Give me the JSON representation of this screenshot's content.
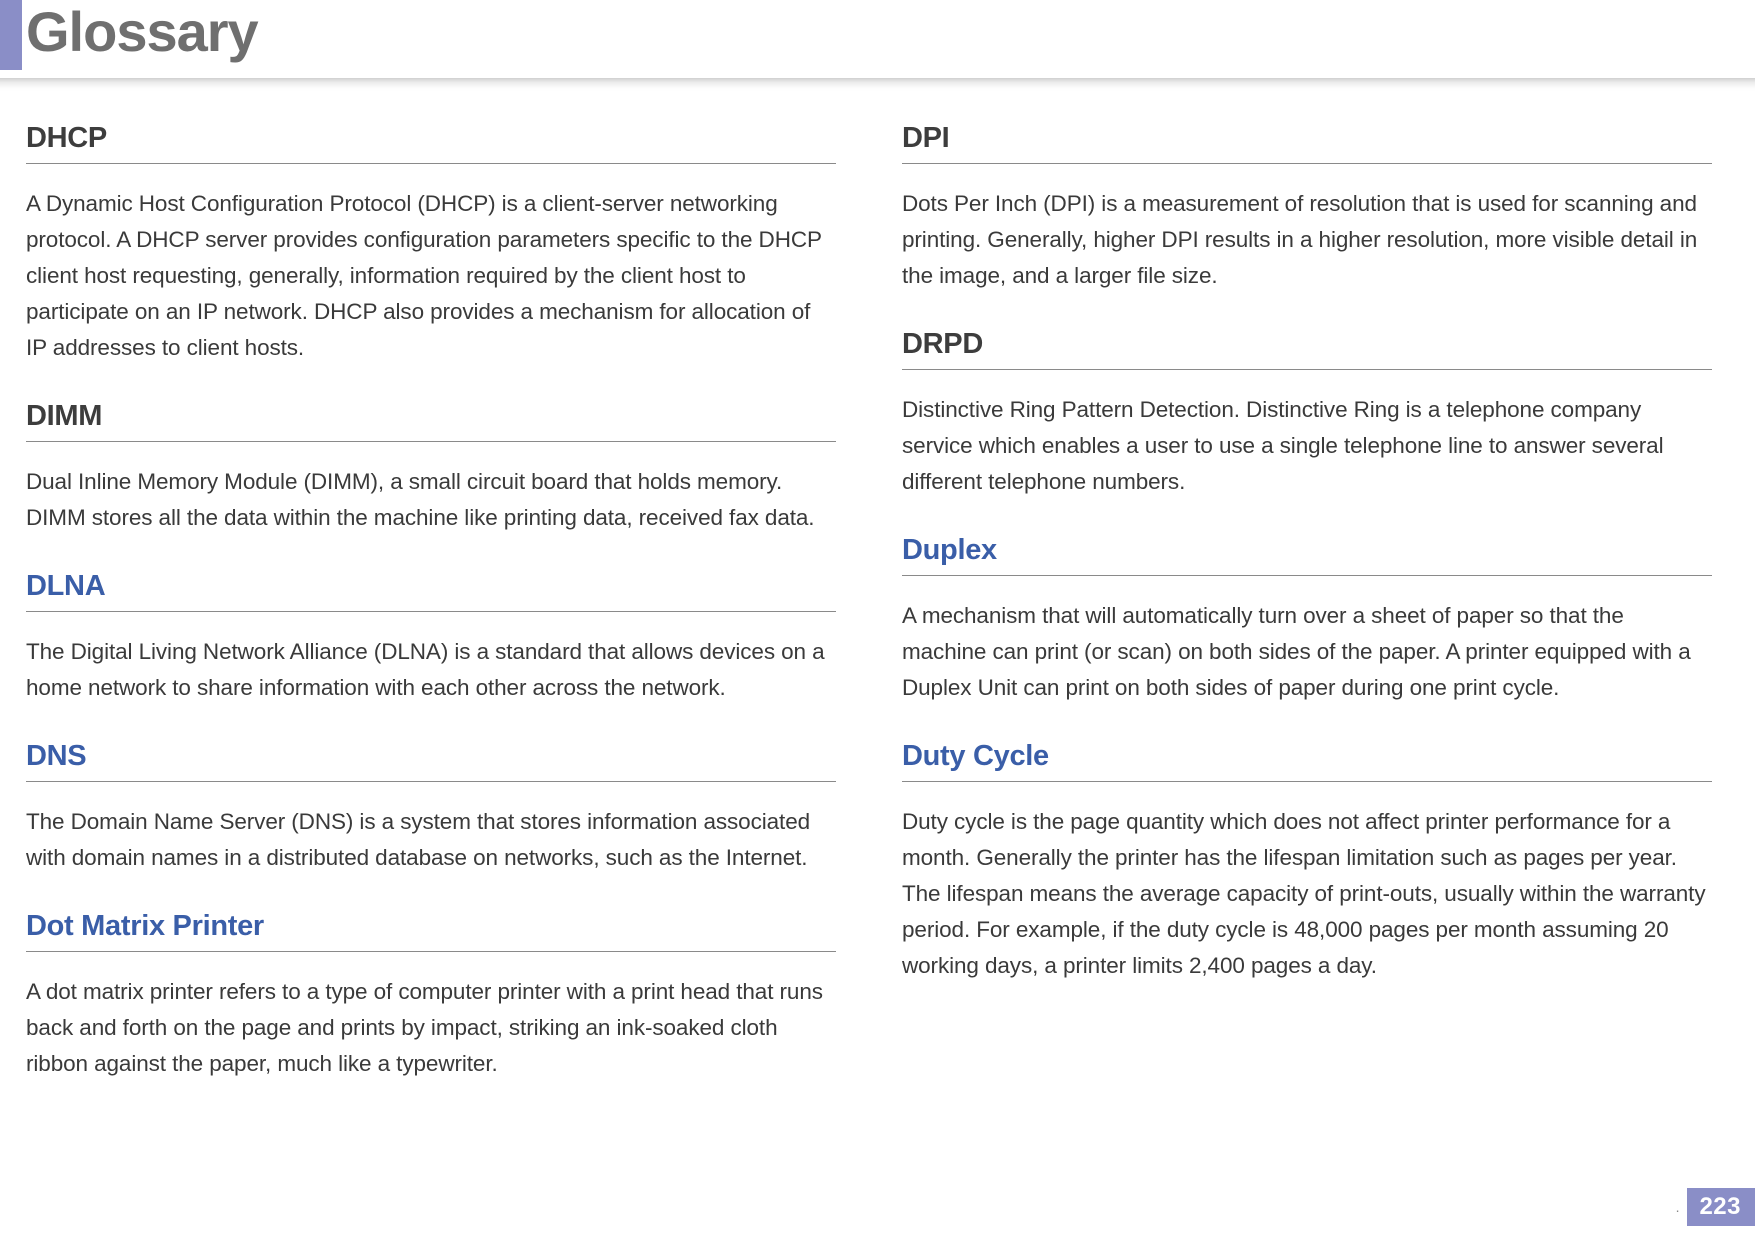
{
  "header": {
    "title": "Glossary"
  },
  "left": [
    {
      "style": "dark",
      "term": "DHCP",
      "definition": "A Dynamic Host Configuration Protocol (DHCP) is a client-server networking protocol. A DHCP server provides configuration parameters specific to the DHCP client host requesting, generally, information required by the client host to participate on an IP network. DHCP also provides a mechanism for allocation of IP addresses to client hosts."
    },
    {
      "style": "dark",
      "term": "DIMM",
      "definition": "Dual Inline Memory Module (DIMM), a small circuit board that holds memory. DIMM stores all the data within the machine like printing data, received fax data."
    },
    {
      "style": "blue",
      "term": "DLNA",
      "definition": "The Digital Living Network Alliance (DLNA) is a standard that allows devices on a home network to share information with each other across the network."
    },
    {
      "style": "blue",
      "term": "DNS",
      "definition": "The Domain Name Server (DNS) is a system that stores information associated with domain names in a distributed database on networks, such as the Internet."
    },
    {
      "style": "blue",
      "term": "Dot Matrix Printer",
      "definition": "A dot matrix printer refers to a type of computer printer with a print head that runs back and forth on the page and prints by impact, striking an ink-soaked cloth ribbon against the paper, much like a typewriter."
    }
  ],
  "right": [
    {
      "style": "dark",
      "term": "DPI",
      "definition": "Dots Per Inch (DPI) is a measurement of resolution that is used for scanning and printing. Generally, higher DPI results in a higher resolution, more visible detail in the image, and a larger file size."
    },
    {
      "style": "dark",
      "term": "DRPD",
      "definition": "Distinctive Ring Pattern Detection. Distinctive Ring is a telephone company service which enables a user to use a single telephone line to answer several different telephone numbers."
    },
    {
      "style": "blue",
      "term": "Duplex",
      "definition": "A mechanism that will automatically turn over a sheet of paper so that the machine can print (or scan) on both sides of the paper. A printer equipped with a Duplex Unit can print on both sides of paper during one print cycle."
    },
    {
      "style": "blue",
      "term": "Duty Cycle",
      "definition": "Duty cycle is the page quantity which does not affect printer performance for a month. Generally the printer has the lifespan limitation such as pages per year. The lifespan means the average capacity of print-outs, usually within the warranty period. For example, if the duty cycle is 48,000 pages per month assuming 20 working days, a printer limits 2,400 pages a day."
    }
  ],
  "footer": {
    "dot": ".",
    "page": "223"
  }
}
